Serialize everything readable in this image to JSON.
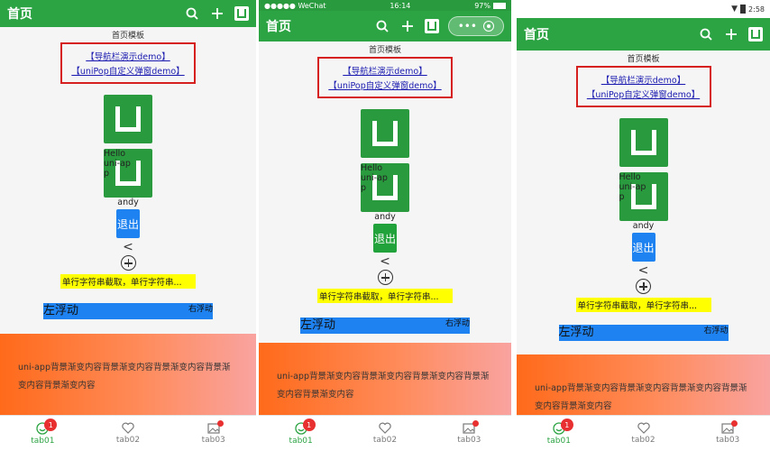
{
  "nav": {
    "title": "首页",
    "page_label": "首页模板"
  },
  "links": {
    "nav_demo": "【导航栏演示demo】",
    "popup_demo": "【uniPop自定义弹窗demo】"
  },
  "hero": {
    "overlay_text": "Hello uni-app"
  },
  "user": {
    "name": "andy",
    "logout_label": "退出"
  },
  "symbols": {
    "chevron": "<"
  },
  "marquee_text": "单行字符串截取，单行字符串...",
  "float": {
    "left": "左浮动",
    "right": "右浮动"
  },
  "gradient_text": "uni-app背景渐变内容背景渐变内容背景渐变内容背景渐变内容背景渐变内容",
  "tabs": [
    {
      "label": "tab01",
      "badge": "1"
    },
    {
      "label": "tab02"
    },
    {
      "label": "tab03"
    }
  ],
  "status_ios": {
    "carrier": "●●●●● WeChat",
    "time": "16:14",
    "battery": "97%"
  },
  "status_android": {
    "time": "2:58"
  },
  "colors": {
    "nav_green": "#2da444",
    "link_red": "#d62020",
    "logout_blue": "#1e82f0",
    "logout_green": "#22a23a",
    "marquee_yellow": "#ffff00",
    "badge_red": "#e83030"
  }
}
